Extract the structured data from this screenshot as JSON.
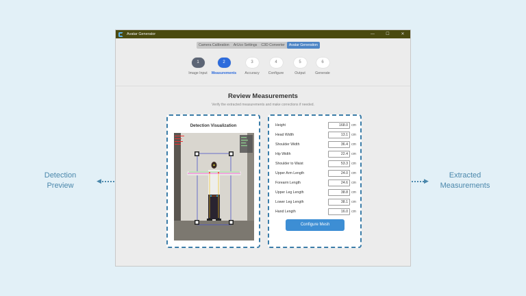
{
  "annotations": {
    "left_label": "Detection Preview",
    "right_label": "Extracted Measurements"
  },
  "window": {
    "title": "Avatar Generator",
    "controls": [
      "—",
      "☐",
      "✕"
    ]
  },
  "tabs": [
    {
      "label": "Camera Calibration",
      "active": false
    },
    {
      "label": "ArUco Settings",
      "active": false
    },
    {
      "label": "C3D Converter",
      "active": false
    },
    {
      "label": "Avatar Generation",
      "active": true
    }
  ],
  "steps": [
    {
      "number": "1",
      "label": "Image Input",
      "state": "done"
    },
    {
      "number": "2",
      "label": "Measurements",
      "state": "current"
    },
    {
      "number": "3",
      "label": "Accuracy",
      "state": "pending"
    },
    {
      "number": "4",
      "label": "Configure",
      "state": "pending"
    },
    {
      "number": "5",
      "label": "Output",
      "state": "pending"
    },
    {
      "number": "6",
      "label": "Generate",
      "state": "pending"
    }
  ],
  "review": {
    "title": "Review Measurements",
    "subtitle": "Verify the extracted measurements and make corrections if needed."
  },
  "visualization": {
    "title": "Detection Visualization"
  },
  "measurements": [
    {
      "label": "Height",
      "value": "168.0",
      "unit": "cm"
    },
    {
      "label": "Head Width",
      "value": "13.1",
      "unit": "cm"
    },
    {
      "label": "Shoulder Width",
      "value": "36.4",
      "unit": "cm"
    },
    {
      "label": "Hip Width",
      "value": "22.4",
      "unit": "cm"
    },
    {
      "label": "Shoulder to Waist",
      "value": "53.3",
      "unit": "cm"
    },
    {
      "label": "Upper Arm Length",
      "value": "24.0",
      "unit": "cm"
    },
    {
      "label": "Forearm Length",
      "value": "24.6",
      "unit": "cm"
    },
    {
      "label": "Upper Leg Length",
      "value": "38.8",
      "unit": "cm"
    },
    {
      "label": "Lower Leg Length",
      "value": "38.1",
      "unit": "cm"
    },
    {
      "label": "Hand Length",
      "value": "16.0",
      "unit": "cm"
    }
  ],
  "configure_button": "Configure Mesh",
  "colors": {
    "accent": "#2d6bdc",
    "button": "#3d8ed4",
    "annotation": "#4a87ab",
    "titlebar": "#4a4a10"
  }
}
